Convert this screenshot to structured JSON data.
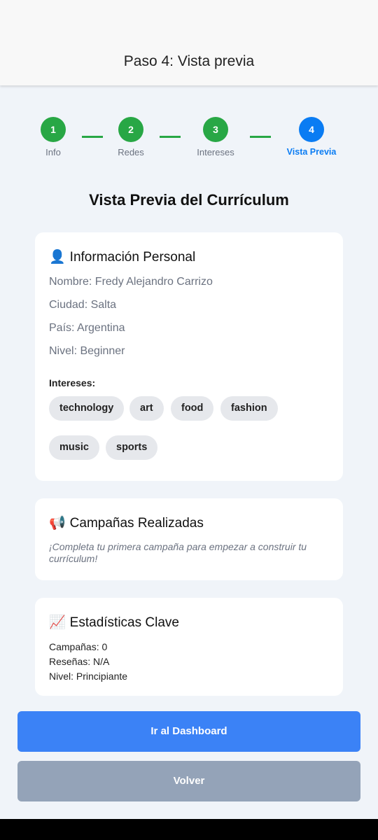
{
  "header": {
    "title": "Paso 4: Vista previa"
  },
  "stepper": {
    "steps": [
      {
        "number": "1",
        "label": "Info"
      },
      {
        "number": "2",
        "label": "Redes"
      },
      {
        "number": "3",
        "label": "Intereses"
      },
      {
        "number": "4",
        "label": "Vista Previa"
      }
    ],
    "done_color": "#28a745",
    "active_color": "#0a7cf3"
  },
  "main": {
    "title": "Vista Previa del Currículum"
  },
  "personal": {
    "icon": "user-icon",
    "title": "Información Personal",
    "lines": [
      "Nombre: Fredy Alejandro Carrizo",
      "Ciudad: Salta",
      "País: Argentina",
      "Nivel: Beginner"
    ],
    "interests_label": "Intereses:",
    "interests": [
      "technology",
      "art",
      "food",
      "fashion",
      "music",
      "sports"
    ]
  },
  "campaigns": {
    "icon": "megaphone-icon",
    "title": "Campañas Realizadas",
    "empty_message": "¡Completa tu primera campaña para empezar a construir tu currículum!"
  },
  "stats": {
    "icon": "chart-increasing-icon",
    "title": "Estadísticas Clave",
    "lines": [
      "Campañas: 0",
      "Reseñas: N/A",
      "Nivel: Principiante"
    ]
  },
  "actions": {
    "primary_label": "Ir al Dashboard",
    "secondary_label": "Volver",
    "primary_color": "#3b82f6",
    "secondary_color": "#94a3b8"
  }
}
